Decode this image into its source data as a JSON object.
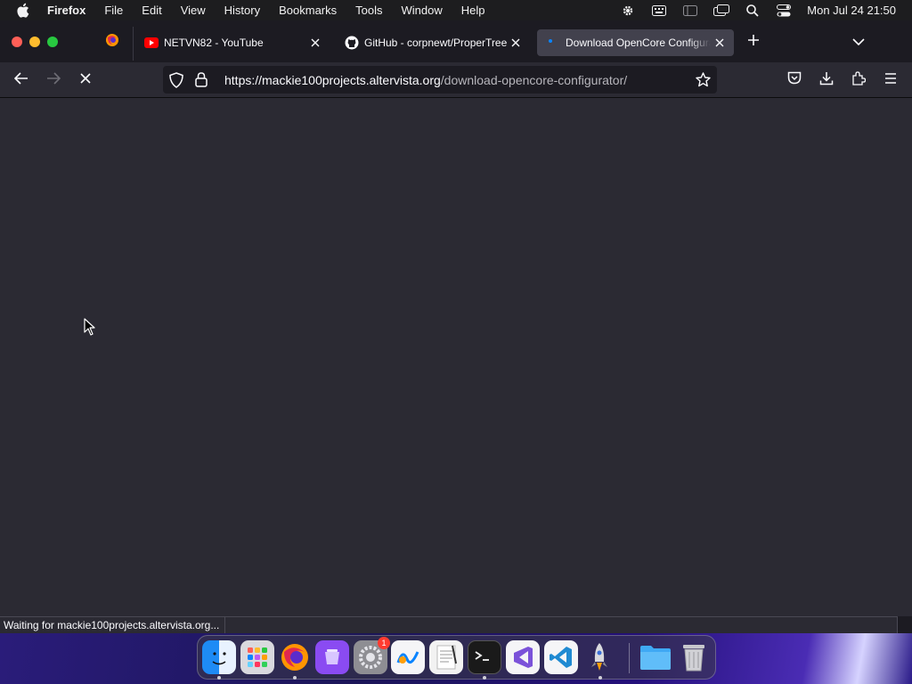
{
  "menubar": {
    "apple_icon": "apple-icon",
    "items": [
      "Firefox",
      "File",
      "Edit",
      "View",
      "History",
      "Bookmarks",
      "Tools",
      "Window",
      "Help"
    ],
    "status_icons": [
      "gear-icon",
      "keyboard-icon",
      "sidebar-icon",
      "screen-mirroring-icon",
      "search-icon",
      "control-center-icon"
    ],
    "clock": "Mon Jul 24  21:50"
  },
  "tabs": [
    {
      "title": "NETVN82 - YouTube",
      "favicon": "youtube-icon",
      "active": false
    },
    {
      "title": "GitHub - corpnewt/ProperTree: C",
      "favicon": "github-icon",
      "active": false
    },
    {
      "title": "Download OpenCore Configurator",
      "favicon": "loading-icon",
      "active": true
    }
  ],
  "pinned_tab": {
    "favicon": "firefox-icon"
  },
  "navbar": {
    "url_domain": "https://mackie100projects.altervista.org",
    "url_path": "/download-opencore-configurator/",
    "buttons": [
      "back-icon",
      "forward-icon",
      "stop-icon",
      "pocket-icon",
      "download-icon",
      "extensions-icon",
      "menu-icon"
    ]
  },
  "status": {
    "text": "Waiting for mackie100projects.altervista.org..."
  },
  "dock": {
    "items": [
      "finder-icon",
      "launchpad-icon",
      "firefox-icon",
      "podcasts-icon",
      "system-settings-icon",
      "freeform-icon",
      "textedit-icon",
      "terminal-icon",
      "visual-studio-icon",
      "vscode-icon",
      "rocket-icon",
      "downloads-folder-icon",
      "trash-icon"
    ],
    "settings_badge": "1"
  },
  "colors": {
    "accent": "#0a84ff",
    "page_bg": "#2b2a33",
    "chrome_bg": "#1c1b22",
    "toolbar_bg": "#2b2a33"
  }
}
